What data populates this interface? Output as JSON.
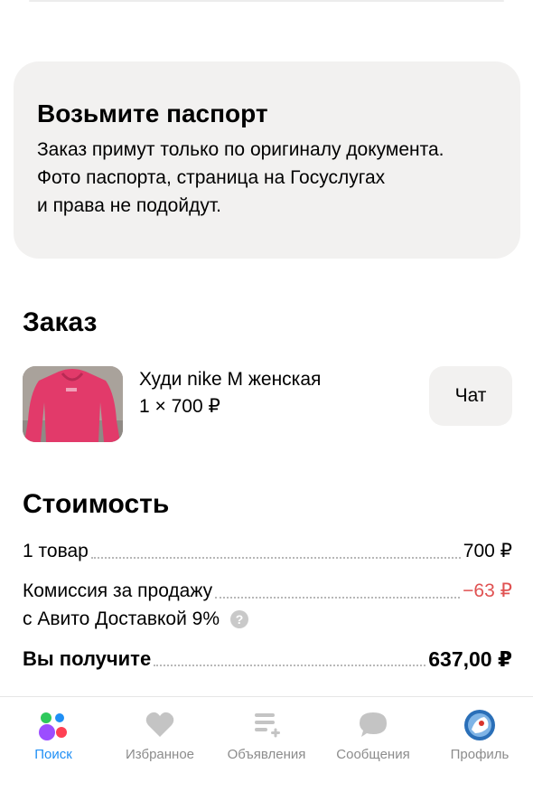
{
  "passport_card": {
    "title": "Возьмите паспорт",
    "line1": "Заказ примут только по оригиналу документа.",
    "line2": "Фото паспорта, страница на Госуслугах",
    "line3": "и права не подойдут."
  },
  "order": {
    "title": "Заказ",
    "product_name": "Худи nike M женская",
    "product_qty": "1 × 700 ₽",
    "chat_label": "Чат"
  },
  "cost": {
    "title": "Стоимость",
    "item_label": "1 товар",
    "item_value": "700 ₽",
    "fee_label_line1": "Комиссия за продажу",
    "fee_label_line2": "с Авито Доставкой 9%",
    "fee_value": "−63 ₽",
    "help_glyph": "?",
    "total_label": "Вы получите",
    "total_value": "637,00 ₽"
  },
  "tabbar": {
    "tabs": [
      {
        "label": "Поиск",
        "icon": "search-dots-icon",
        "active": true
      },
      {
        "label": "Избранное",
        "icon": "heart-icon",
        "active": false
      },
      {
        "label": "Объявления",
        "icon": "list-add-icon",
        "active": false
      },
      {
        "label": "Сообщения",
        "icon": "chat-bubble-icon",
        "active": false
      },
      {
        "label": "Профиль",
        "icon": "avatar-icon",
        "active": false
      }
    ]
  },
  "colors": {
    "accent": "#1f8ff5",
    "negative": "#e05252",
    "card_bg": "#f2f1f0",
    "product_color": "#e23a6a"
  }
}
